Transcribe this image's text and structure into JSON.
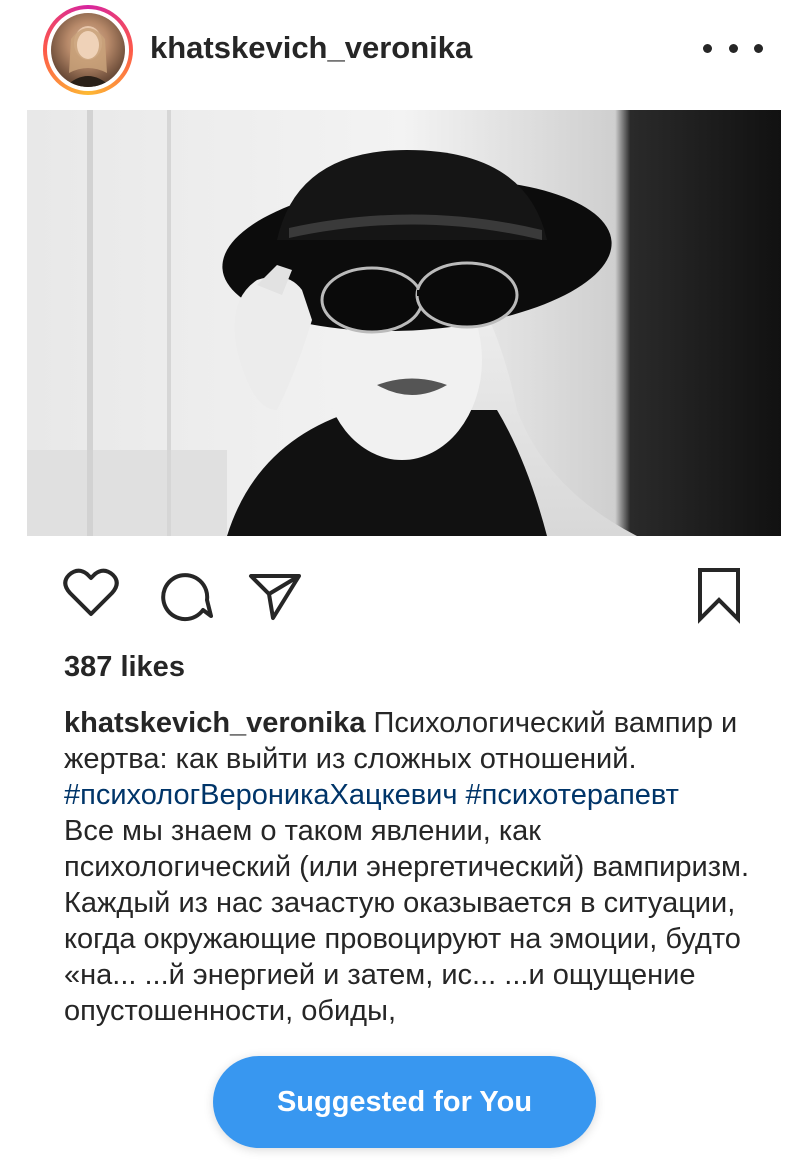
{
  "header": {
    "username": "khatskevich_veronika",
    "more_icon": "more-horizontal-icon"
  },
  "actions": {
    "like_icon": "heart-icon",
    "comment_icon": "comment-icon",
    "share_icon": "send-icon",
    "save_icon": "bookmark-icon"
  },
  "post": {
    "likes": "387 likes",
    "caption_user": "khatskevich_veronika",
    "caption_text": " Психологический вампир и жертва: как выйти из сложных отношений. ",
    "hashtags": [
      "#психологВероникаХацкевич",
      "#психотерапевт"
    ],
    "body": "Все мы знаем о таком явлении, как психологический (или энергетический) вампиризм. Каждый из нас зачастую оказывается в ситуации, когда окружающие провоцируют на эмоции, будто «на... ...й энергией и затем, ис... ...и ощущение опустошенности, обиды,"
  },
  "suggested": {
    "label": "Suggested for You"
  },
  "colors": {
    "text": "#262626",
    "hashtag": "#003569",
    "pill": "#3897f0"
  }
}
